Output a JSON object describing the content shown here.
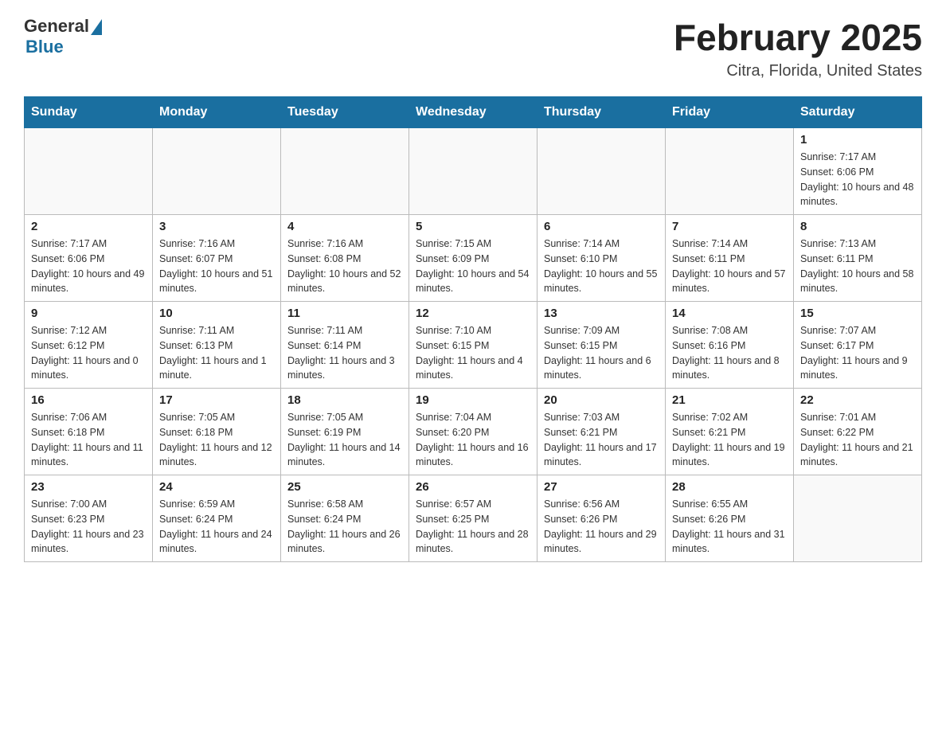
{
  "header": {
    "logo_general": "General",
    "logo_blue": "Blue",
    "title": "February 2025",
    "location": "Citra, Florida, United States"
  },
  "days_of_week": [
    "Sunday",
    "Monday",
    "Tuesday",
    "Wednesday",
    "Thursday",
    "Friday",
    "Saturday"
  ],
  "weeks": [
    [
      {
        "day": "",
        "sunrise": "",
        "sunset": "",
        "daylight": ""
      },
      {
        "day": "",
        "sunrise": "",
        "sunset": "",
        "daylight": ""
      },
      {
        "day": "",
        "sunrise": "",
        "sunset": "",
        "daylight": ""
      },
      {
        "day": "",
        "sunrise": "",
        "sunset": "",
        "daylight": ""
      },
      {
        "day": "",
        "sunrise": "",
        "sunset": "",
        "daylight": ""
      },
      {
        "day": "",
        "sunrise": "",
        "sunset": "",
        "daylight": ""
      },
      {
        "day": "1",
        "sunrise": "Sunrise: 7:17 AM",
        "sunset": "Sunset: 6:06 PM",
        "daylight": "Daylight: 10 hours and 48 minutes."
      }
    ],
    [
      {
        "day": "2",
        "sunrise": "Sunrise: 7:17 AM",
        "sunset": "Sunset: 6:06 PM",
        "daylight": "Daylight: 10 hours and 49 minutes."
      },
      {
        "day": "3",
        "sunrise": "Sunrise: 7:16 AM",
        "sunset": "Sunset: 6:07 PM",
        "daylight": "Daylight: 10 hours and 51 minutes."
      },
      {
        "day": "4",
        "sunrise": "Sunrise: 7:16 AM",
        "sunset": "Sunset: 6:08 PM",
        "daylight": "Daylight: 10 hours and 52 minutes."
      },
      {
        "day": "5",
        "sunrise": "Sunrise: 7:15 AM",
        "sunset": "Sunset: 6:09 PM",
        "daylight": "Daylight: 10 hours and 54 minutes."
      },
      {
        "day": "6",
        "sunrise": "Sunrise: 7:14 AM",
        "sunset": "Sunset: 6:10 PM",
        "daylight": "Daylight: 10 hours and 55 minutes."
      },
      {
        "day": "7",
        "sunrise": "Sunrise: 7:14 AM",
        "sunset": "Sunset: 6:11 PM",
        "daylight": "Daylight: 10 hours and 57 minutes."
      },
      {
        "day": "8",
        "sunrise": "Sunrise: 7:13 AM",
        "sunset": "Sunset: 6:11 PM",
        "daylight": "Daylight: 10 hours and 58 minutes."
      }
    ],
    [
      {
        "day": "9",
        "sunrise": "Sunrise: 7:12 AM",
        "sunset": "Sunset: 6:12 PM",
        "daylight": "Daylight: 11 hours and 0 minutes."
      },
      {
        "day": "10",
        "sunrise": "Sunrise: 7:11 AM",
        "sunset": "Sunset: 6:13 PM",
        "daylight": "Daylight: 11 hours and 1 minute."
      },
      {
        "day": "11",
        "sunrise": "Sunrise: 7:11 AM",
        "sunset": "Sunset: 6:14 PM",
        "daylight": "Daylight: 11 hours and 3 minutes."
      },
      {
        "day": "12",
        "sunrise": "Sunrise: 7:10 AM",
        "sunset": "Sunset: 6:15 PM",
        "daylight": "Daylight: 11 hours and 4 minutes."
      },
      {
        "day": "13",
        "sunrise": "Sunrise: 7:09 AM",
        "sunset": "Sunset: 6:15 PM",
        "daylight": "Daylight: 11 hours and 6 minutes."
      },
      {
        "day": "14",
        "sunrise": "Sunrise: 7:08 AM",
        "sunset": "Sunset: 6:16 PM",
        "daylight": "Daylight: 11 hours and 8 minutes."
      },
      {
        "day": "15",
        "sunrise": "Sunrise: 7:07 AM",
        "sunset": "Sunset: 6:17 PM",
        "daylight": "Daylight: 11 hours and 9 minutes."
      }
    ],
    [
      {
        "day": "16",
        "sunrise": "Sunrise: 7:06 AM",
        "sunset": "Sunset: 6:18 PM",
        "daylight": "Daylight: 11 hours and 11 minutes."
      },
      {
        "day": "17",
        "sunrise": "Sunrise: 7:05 AM",
        "sunset": "Sunset: 6:18 PM",
        "daylight": "Daylight: 11 hours and 12 minutes."
      },
      {
        "day": "18",
        "sunrise": "Sunrise: 7:05 AM",
        "sunset": "Sunset: 6:19 PM",
        "daylight": "Daylight: 11 hours and 14 minutes."
      },
      {
        "day": "19",
        "sunrise": "Sunrise: 7:04 AM",
        "sunset": "Sunset: 6:20 PM",
        "daylight": "Daylight: 11 hours and 16 minutes."
      },
      {
        "day": "20",
        "sunrise": "Sunrise: 7:03 AM",
        "sunset": "Sunset: 6:21 PM",
        "daylight": "Daylight: 11 hours and 17 minutes."
      },
      {
        "day": "21",
        "sunrise": "Sunrise: 7:02 AM",
        "sunset": "Sunset: 6:21 PM",
        "daylight": "Daylight: 11 hours and 19 minutes."
      },
      {
        "day": "22",
        "sunrise": "Sunrise: 7:01 AM",
        "sunset": "Sunset: 6:22 PM",
        "daylight": "Daylight: 11 hours and 21 minutes."
      }
    ],
    [
      {
        "day": "23",
        "sunrise": "Sunrise: 7:00 AM",
        "sunset": "Sunset: 6:23 PM",
        "daylight": "Daylight: 11 hours and 23 minutes."
      },
      {
        "day": "24",
        "sunrise": "Sunrise: 6:59 AM",
        "sunset": "Sunset: 6:24 PM",
        "daylight": "Daylight: 11 hours and 24 minutes."
      },
      {
        "day": "25",
        "sunrise": "Sunrise: 6:58 AM",
        "sunset": "Sunset: 6:24 PM",
        "daylight": "Daylight: 11 hours and 26 minutes."
      },
      {
        "day": "26",
        "sunrise": "Sunrise: 6:57 AM",
        "sunset": "Sunset: 6:25 PM",
        "daylight": "Daylight: 11 hours and 28 minutes."
      },
      {
        "day": "27",
        "sunrise": "Sunrise: 6:56 AM",
        "sunset": "Sunset: 6:26 PM",
        "daylight": "Daylight: 11 hours and 29 minutes."
      },
      {
        "day": "28",
        "sunrise": "Sunrise: 6:55 AM",
        "sunset": "Sunset: 6:26 PM",
        "daylight": "Daylight: 11 hours and 31 minutes."
      },
      {
        "day": "",
        "sunrise": "",
        "sunset": "",
        "daylight": ""
      }
    ]
  ]
}
